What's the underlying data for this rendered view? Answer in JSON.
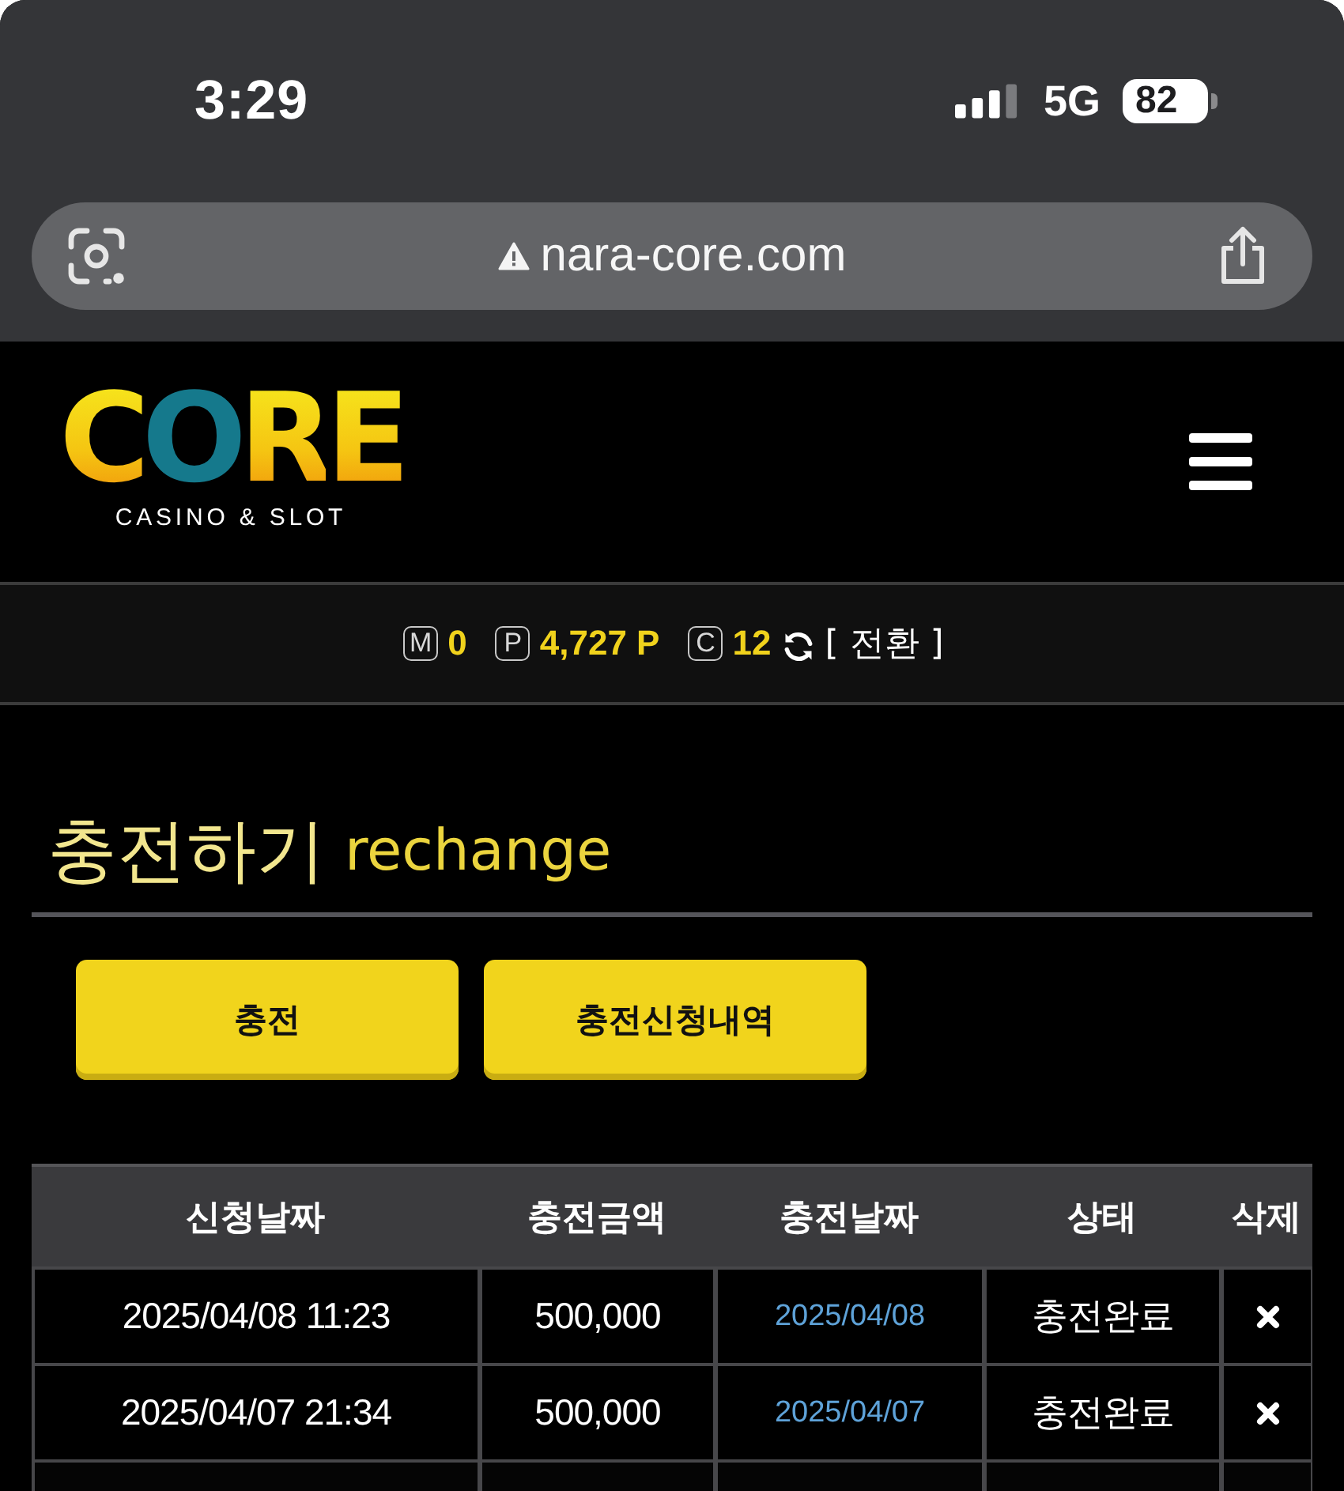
{
  "status_bar": {
    "time": "3:29",
    "network": "5G",
    "battery": "82"
  },
  "browser": {
    "url": "nara-core.com"
  },
  "header": {
    "logo": {
      "wordmark": "CORE",
      "tagline": "CASINO & SLOT"
    }
  },
  "points_bar": {
    "items": [
      {
        "symbol": "M",
        "value": "0"
      },
      {
        "symbol": "P",
        "value": "4,727 P"
      },
      {
        "symbol": "C",
        "value": "12"
      }
    ],
    "convert_label": "[ 전환 ]"
  },
  "page": {
    "title": "충전하기",
    "subtitle": "rechange"
  },
  "buttons": [
    {
      "label": "충전"
    },
    {
      "label": "충전신청내역"
    }
  ],
  "table": {
    "columns": [
      {
        "label": "신청날짜",
        "kind": "text"
      },
      {
        "label": "충전금액",
        "kind": "text"
      },
      {
        "label": "충전날짜",
        "kind": "link"
      },
      {
        "label": "상태",
        "kind": "text"
      },
      {
        "label": "삭제",
        "kind": "delete"
      }
    ],
    "rows": [
      {
        "cells": [
          "2025/04/08 11:23",
          "500,000",
          "2025/04/08",
          "충전완료"
        ]
      },
      {
        "cells": [
          "2025/04/07 21:34",
          "500,000",
          "2025/04/07",
          "충전완료"
        ]
      }
    ]
  }
}
